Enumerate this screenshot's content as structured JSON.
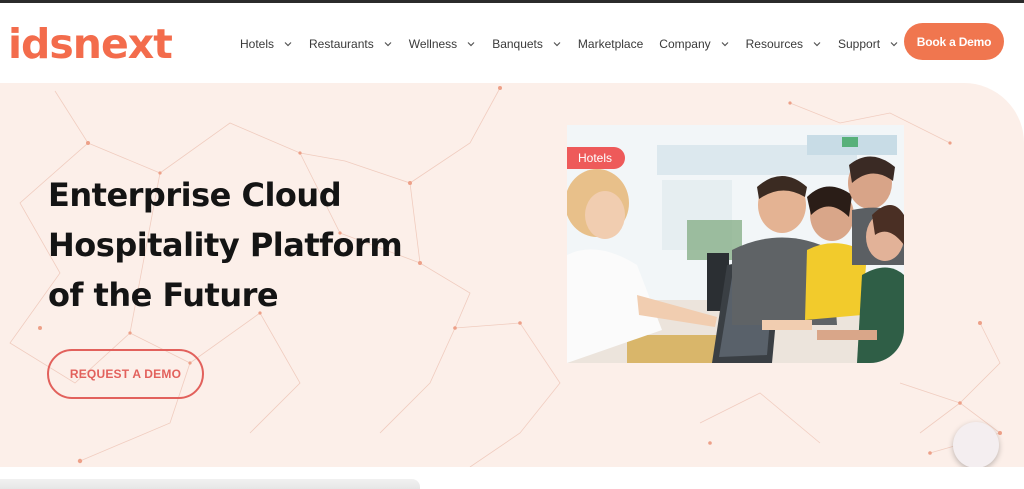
{
  "brand": {
    "logo_text": "idsnext",
    "accent_color": "#f0764f",
    "hero_background": "#fcefe9"
  },
  "nav": {
    "items": [
      {
        "label": "Hotels",
        "has_dropdown": true
      },
      {
        "label": "Restaurants",
        "has_dropdown": true
      },
      {
        "label": "Wellness",
        "has_dropdown": true
      },
      {
        "label": "Banquets",
        "has_dropdown": true
      },
      {
        "label": "Marketplace",
        "has_dropdown": false
      },
      {
        "label": "Company",
        "has_dropdown": true
      },
      {
        "label": "Resources",
        "has_dropdown": true
      },
      {
        "label": "Support",
        "has_dropdown": true
      }
    ],
    "cta_label": "Book a Demo"
  },
  "hero": {
    "headline_lines": [
      "Enterprise Cloud",
      "Hospitality Platform",
      "of the Future"
    ],
    "cta_label": "REQUEST A DEMO",
    "image_tag": "Hotels",
    "image_icon": "hotel-front-desk-photo"
  },
  "widgets": {
    "chat_icon": "chat-bubble-icon"
  }
}
